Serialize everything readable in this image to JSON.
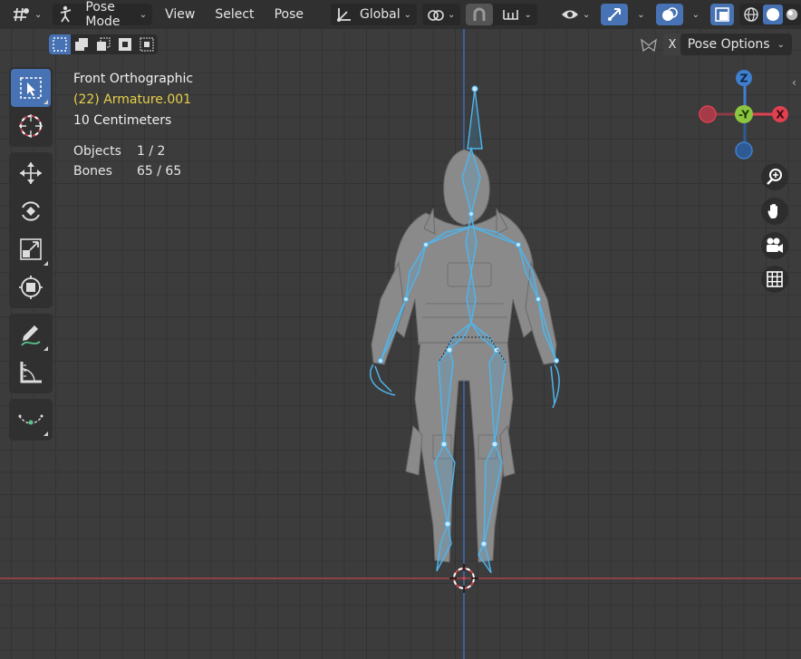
{
  "header": {
    "mode_label": "Pose Mode",
    "menus": [
      "View",
      "Select",
      "Pose"
    ],
    "orientation_label": "Global"
  },
  "subheader": {
    "x_label": "X",
    "pose_options_label": "Pose Options"
  },
  "overlay": {
    "view_name": "Front Orthographic",
    "object_name": "(22) Armature.001",
    "scale": "10 Centimeters",
    "stats": [
      {
        "label": "Objects",
        "value": "1 / 2"
      },
      {
        "label": "Bones",
        "value": "65 / 65"
      }
    ]
  },
  "gizmo": {
    "z_label": "Z",
    "y_label": "-Y",
    "x_label": "X"
  },
  "colors": {
    "accent": "#4772b3",
    "axis_x": "#e04050",
    "axis_y": "#8bc63f",
    "axis_z": "#3f7fd0",
    "bone_selected": "#4fb5ee",
    "object_name": "#e7d04a"
  }
}
